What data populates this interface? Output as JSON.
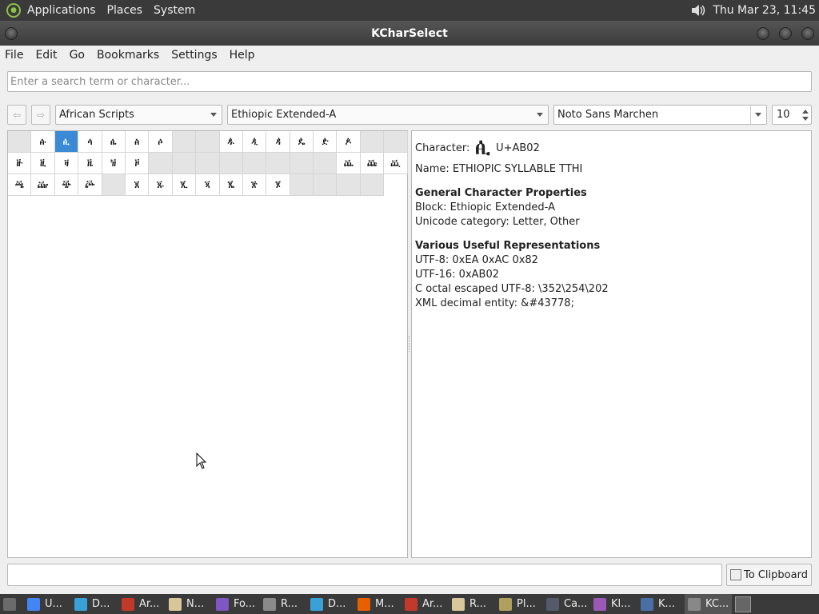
{
  "top_panel": {
    "menus": [
      "Applications",
      "Places",
      "System"
    ],
    "clock": "Thu Mar 23, 11:45"
  },
  "window": {
    "title": "KCharSelect"
  },
  "menubar": {
    "items": [
      "File",
      "Edit",
      "Go",
      "Bookmarks",
      "Settings",
      "Help"
    ]
  },
  "search": {
    "placeholder": "Enter a search term or character..."
  },
  "toolbar": {
    "section": "African Scripts",
    "block": "Ethiopic Extended-A",
    "font": "Noto Sans Marchen",
    "size": "10"
  },
  "grid": {
    "selected_index": 2,
    "cells": [
      "",
      "ꬁ",
      "ꬂ",
      "ꬃ",
      "ꬄ",
      "ꬅ",
      "ꬆ",
      "",
      "",
      "ꬉ",
      "ꬊ",
      "ꬋ",
      "ꬌ",
      "ꬍ",
      "ꬎ",
      "",
      "",
      "ꬑ",
      "ꬒ",
      "ꬓ",
      "ꬔ",
      "ꬕ",
      "ꬖ",
      "",
      "",
      "",
      "",
      "",
      "",
      "",
      "",
      "ꬠ",
      "ꬡ",
      "ꬢ",
      "ꬣ",
      "ꬤ",
      "ꬥ",
      "ꬦ",
      "",
      "ꬨ",
      "ꬩ",
      "ꬪ",
      "ꬫ",
      "ꬬ",
      "ꬭ",
      "ꬮ",
      "",
      "",
      "",
      ""
    ]
  },
  "details": {
    "char_label": "Character:",
    "char_glyph": "ꬂ",
    "codepoint": "U+AB02",
    "name": "Name: ETHIOPIC SYLLABLE TTHI",
    "general_header": "General Character Properties",
    "block": "Block: Ethiopic Extended-A",
    "category": "Unicode category: Letter, Other",
    "repr_header": "Various Useful Representations",
    "utf8": "UTF-8: 0xEA 0xAC 0x82",
    "utf16": "UTF-16: 0xAB02",
    "octal": "C octal escaped UTF-8: \\352\\254\\202",
    "xml": "XML decimal entity: &#43778;"
  },
  "bottom": {
    "clipboard_label": "To Clipboard"
  },
  "taskbar": {
    "items": [
      {
        "label": "",
        "color": "#6b6b6b"
      },
      {
        "label": "U...",
        "color": "#4285f4"
      },
      {
        "label": "D...",
        "color": "#3aa0d8"
      },
      {
        "label": "Ar...",
        "color": "#c0392b"
      },
      {
        "label": "N...",
        "color": "#d8c79a"
      },
      {
        "label": "Fo...",
        "color": "#7e57c2"
      },
      {
        "label": "R...",
        "color": "#8a8a8a"
      },
      {
        "label": "D...",
        "color": "#3aa0d8"
      },
      {
        "label": "M...",
        "color": "#e66000"
      },
      {
        "label": "Ar...",
        "color": "#c0392b"
      },
      {
        "label": "R...",
        "color": "#d8c79a"
      },
      {
        "label": "Pl...",
        "color": "#b0a060"
      },
      {
        "label": "Ca...",
        "color": "#555a6a"
      },
      {
        "label": "Kl...",
        "color": "#9b59b6"
      },
      {
        "label": "K...",
        "color": "#4a6fa5"
      },
      {
        "label": "KC...",
        "color": "#888888"
      }
    ]
  }
}
